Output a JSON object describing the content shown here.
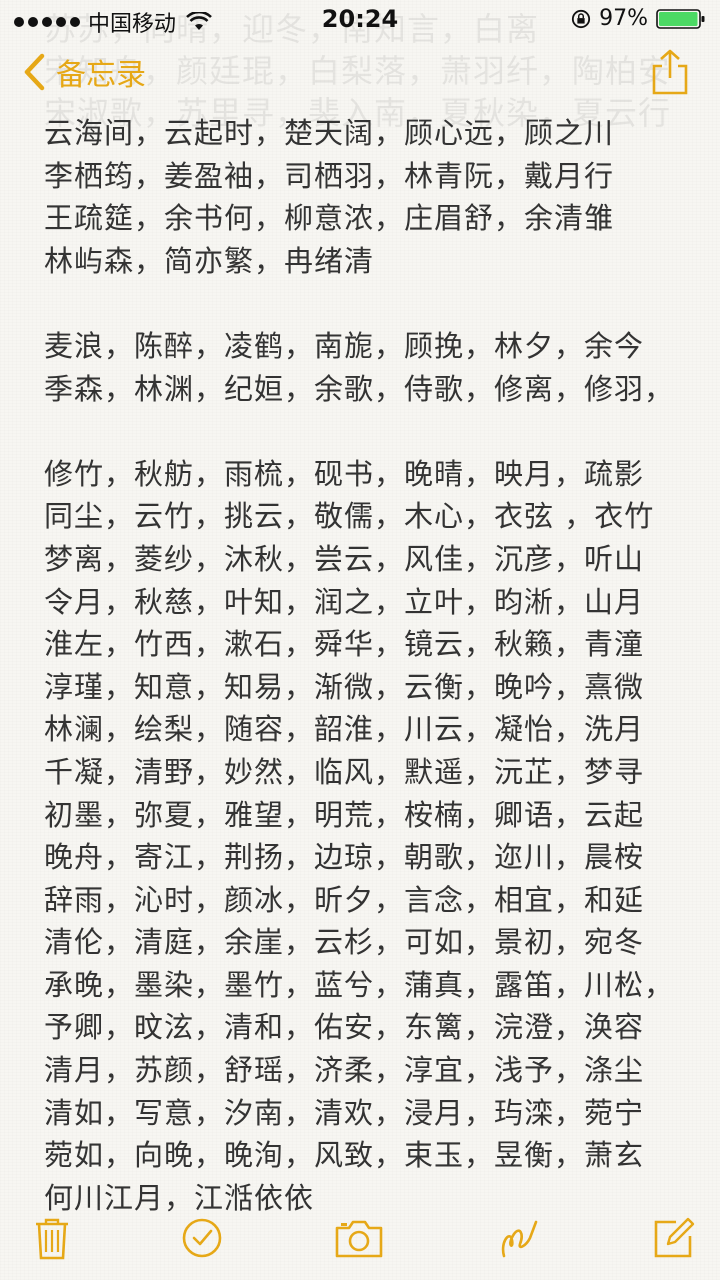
{
  "status_bar": {
    "carrier": "中国移动",
    "time": "20:24",
    "battery_percent": "97%",
    "battery_level": 0.97
  },
  "nav": {
    "back_label": "备忘录",
    "accent_color": "#e6a817"
  },
  "faded_header_lines": [
    "苏苏，向晴，迎冬，南知言，白离",
    "宋知舟，颜廷琨，白梨落，萧羽纤，陶柏安",
    "宋淑歌，苏里寻，裴入南，夏秋染，夏云行"
  ],
  "note_lines": [
    "云海间，云起时，楚天阔，顾心远，顾之川",
    "李栖筠，姜盈袖，司栖羽，林青阮，戴月行",
    "王疏筵，余书何，柳意浓，庄眉舒，余清雏",
    "林屿森，简亦繁，冉绪清",
    "",
    "麦浪，陈醉，凌鹤，南旎，顾挽，林夕，余今",
    "季森，林渊，纪姮，余歌，侍歌，修离，修羽，",
    "",
    "修竹，秋舫，雨梳，砚书，晚晴，映月，疏影",
    "同尘，云竹，挑云，敬儒，木心，衣弦 ，衣竹",
    "梦离，菱纱，沐秋，尝云，风佳，沉彦，听山",
    "令月，秋慈，叶知，润之，立叶，昀淅，山月",
    "淮左，竹西，漱石，舜华，镜云，秋籁，青潼",
    "淳瑾，知意，知易，渐微，云衡，晚吟，熹微",
    "林澜，绘梨，随容，韶淮，川云，凝怡，洗月",
    "千凝，清野，妙然，临风，默遥，沅芷，梦寻",
    "初墨，弥夏，雅望，明荒，桉楠，卿语，云起",
    "晚舟，寄江，荆扬，边琼，朝歌，迩川，晨桉",
    "辞雨，沁时，颜冰，昕夕，言念，相宜，和延",
    "清伦，清庭，余崖，云杉，可如，景初，宛冬",
    "承晚，墨染，墨竹，蓝兮，蒲真，露笛，川松，",
    "予卿，旼泫，清和，佑安，东篱，浣澄，涣容",
    "清月，苏颜，舒瑶，济柔，淳宜，浅予，涤尘",
    "清如，写意，汐南，清欢，浸月，玙滦，菀宁",
    "菀如，向晚，晚洵，风致，束玉，昱衡，萧玄",
    "何川江月，江湉依依"
  ],
  "toolbar": {
    "icons": [
      "trash-icon",
      "checklist-icon",
      "camera-icon",
      "sketch-icon",
      "compose-icon"
    ]
  }
}
